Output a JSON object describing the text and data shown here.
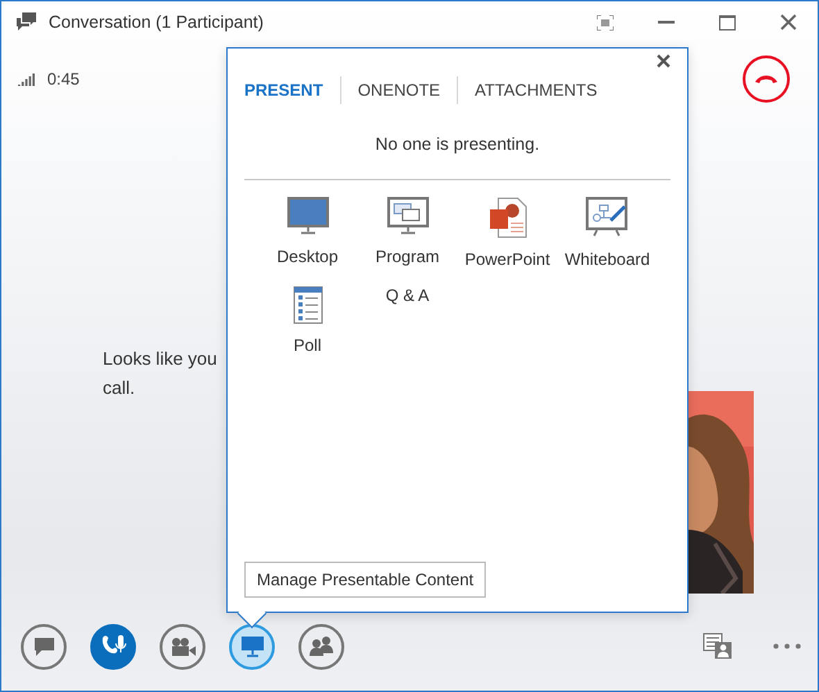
{
  "window": {
    "title": "Conversation (1 Participant)"
  },
  "call": {
    "duration": "0:45"
  },
  "stage": {
    "message_lines": [
      "Looks like you",
      "call."
    ],
    "video": {
      "kind": "picture"
    }
  },
  "present_panel": {
    "tabs": [
      {
        "label": "PRESENT",
        "selected": true
      },
      {
        "label": "ONENOTE",
        "selected": false
      },
      {
        "label": "ATTACHMENTS",
        "selected": false
      }
    ],
    "status": "No one is presenting.",
    "options": [
      {
        "kind": "desktop",
        "label": "Desktop"
      },
      {
        "kind": "program",
        "label": "Program"
      },
      {
        "kind": "powerpoint",
        "label": "PowerPoint"
      },
      {
        "kind": "whiteboard",
        "label": "Whiteboard"
      },
      {
        "kind": "poll",
        "label": "Poll"
      },
      {
        "kind": "qa",
        "label": "Q & A"
      }
    ],
    "manage_button": "Manage Presentable Content"
  },
  "toolbar": {
    "buttons": [
      {
        "kind": "chat",
        "on": false,
        "selected": false
      },
      {
        "kind": "audio",
        "on": true,
        "selected": false
      },
      {
        "kind": "video",
        "on": false,
        "selected": false
      },
      {
        "kind": "present",
        "on": false,
        "selected": true
      },
      {
        "kind": "people",
        "on": false,
        "selected": false
      }
    ]
  }
}
